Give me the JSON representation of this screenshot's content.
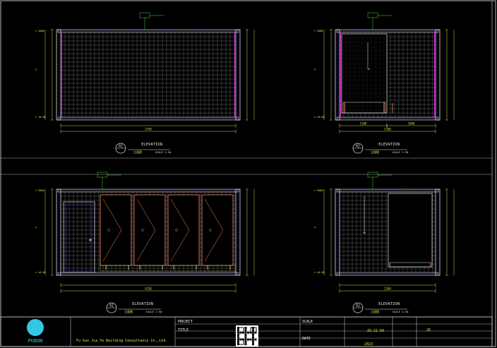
{
  "colors": {
    "background": "#000000",
    "frame": "#e0e0e0",
    "wall": "#3b3bd6",
    "tile": "#bdbdbd",
    "dimension": "#d8d850",
    "accent_magenta": "#e020e0",
    "door": "#ff8c5a",
    "text_yellow": "#e8e840",
    "text_green": "#40e040",
    "logo": "#34c6e6"
  },
  "elevations": [
    {
      "number": "01",
      "title": "ELEVATION",
      "scale": "SCALE 1:50"
    },
    {
      "number": "02",
      "title": "ELEVATION",
      "scale": "SCALE 1:50"
    },
    {
      "number": "01",
      "title": "ELEVATION",
      "scale": "SCALE 1:50"
    },
    {
      "number": "02",
      "title": "ELEVATION",
      "scale": "SCALE 1:50"
    }
  ],
  "dims": {
    "p1_total": "3790",
    "p2_left": "1100",
    "p2_right": "1000",
    "p2_total": "2100",
    "p3_total": "4250",
    "p4_total": "2100"
  },
  "title_block": {
    "logo": "PUBON",
    "company": "Fu Guo Jia Ye Building Consultancy Co.,Ltd.",
    "fields": [
      {
        "label": "PROJECT",
        "value": ""
      },
      {
        "label": "TITLE",
        "value": ""
      },
      {
        "label": "SCALE",
        "value": ""
      },
      {
        "label": "DATE",
        "value": "2023"
      }
    ],
    "drawing_no": "ZS-21-04",
    "sheet": "26"
  }
}
